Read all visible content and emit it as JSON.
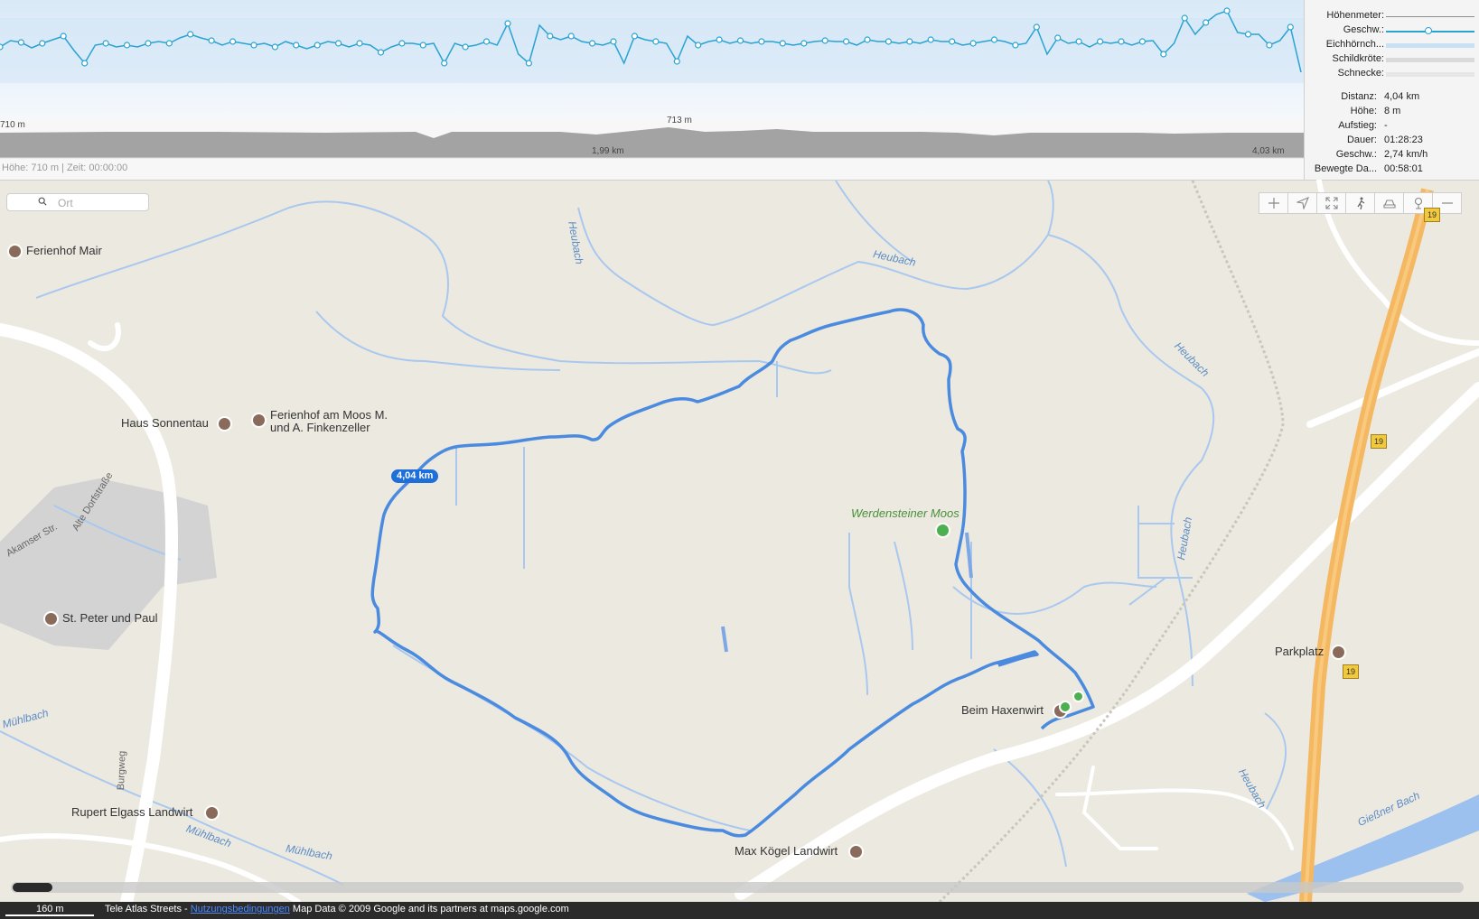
{
  "chart": {
    "left_elevation_label": "710 m",
    "peak_elevation_label": "713 m",
    "mid_distance_label": "1,99 km",
    "end_distance_label": "4,03 km",
    "status_line": "Höhe: 710 m | Zeit: 00:00:00",
    "speed_line_color": "#29a3d1",
    "elevation_fill_color": "#9a9a9a"
  },
  "legend": {
    "items": [
      {
        "label": "Höhenmeter:"
      },
      {
        "label": "Geschw.:"
      },
      {
        "label": "Eichhörnch..."
      },
      {
        "label": "Schildkröte:"
      },
      {
        "label": "Schnecke:"
      }
    ]
  },
  "stats": {
    "items": [
      {
        "label": "Distanz:",
        "value": "4,04 km"
      },
      {
        "label": "Höhe:",
        "value": "8 m"
      },
      {
        "label": "Aufstieg:",
        "value": "-"
      },
      {
        "label": "Dauer:",
        "value": "01:28:23"
      },
      {
        "label": "Geschw.:",
        "value": "2,74 km/h"
      },
      {
        "label": "Bewegte Da...",
        "value": "00:58:01"
      }
    ]
  },
  "search": {
    "placeholder": "Ort"
  },
  "toolbar": {
    "icons": [
      "plus-icon",
      "locate-arrow-icon",
      "fullscreen-icon",
      "walk-icon",
      "car-icon",
      "pin-icon",
      "minus-icon"
    ]
  },
  "map": {
    "route_color": "#4a8be0",
    "distance_badge": "4,04 km",
    "pois": {
      "ferienhof_mair": "Ferienhof Mair",
      "haus_sonnentau": "Haus Sonnentau",
      "ferienhof_moos_1": "Ferienhof am Moos M.",
      "ferienhof_moos_2": "und A. Finkenzeller",
      "st_peter": "St. Peter und Paul",
      "rupert": "Rupert Elgass Landwirt",
      "max_koegel": "Max Kögel Landwirt",
      "haxenwirt": "Beim Haxenwirt",
      "parkplatz": "Parkplatz",
      "werdensteiner": "Werdensteiner Moos"
    },
    "water": {
      "heubach_1": "Heubach",
      "heubach_2": "Heubach",
      "heubach_3": "Heubach",
      "heubach_4": "Heubach",
      "heubach_5": "Heubach",
      "muehlbach_1": "Mühlbach",
      "muehlbach_2": "Mühlbach",
      "muehlbach_3": "Mühlbach",
      "giessner": "Gießner Bach"
    },
    "roads": {
      "alte_dorfstr": "Alte Dorfstraße",
      "akamser": "Akamser Str.",
      "burgweg": "Burgweg",
      "b19": "19"
    }
  },
  "footer": {
    "scale": "160 m",
    "attribution_prefix": "Tele Atlas Streets - ",
    "terms_link": "Nutzungsbedingungen",
    "attribution_suffix": " Map Data © 2009 Google and its partners at maps.google.com"
  }
}
